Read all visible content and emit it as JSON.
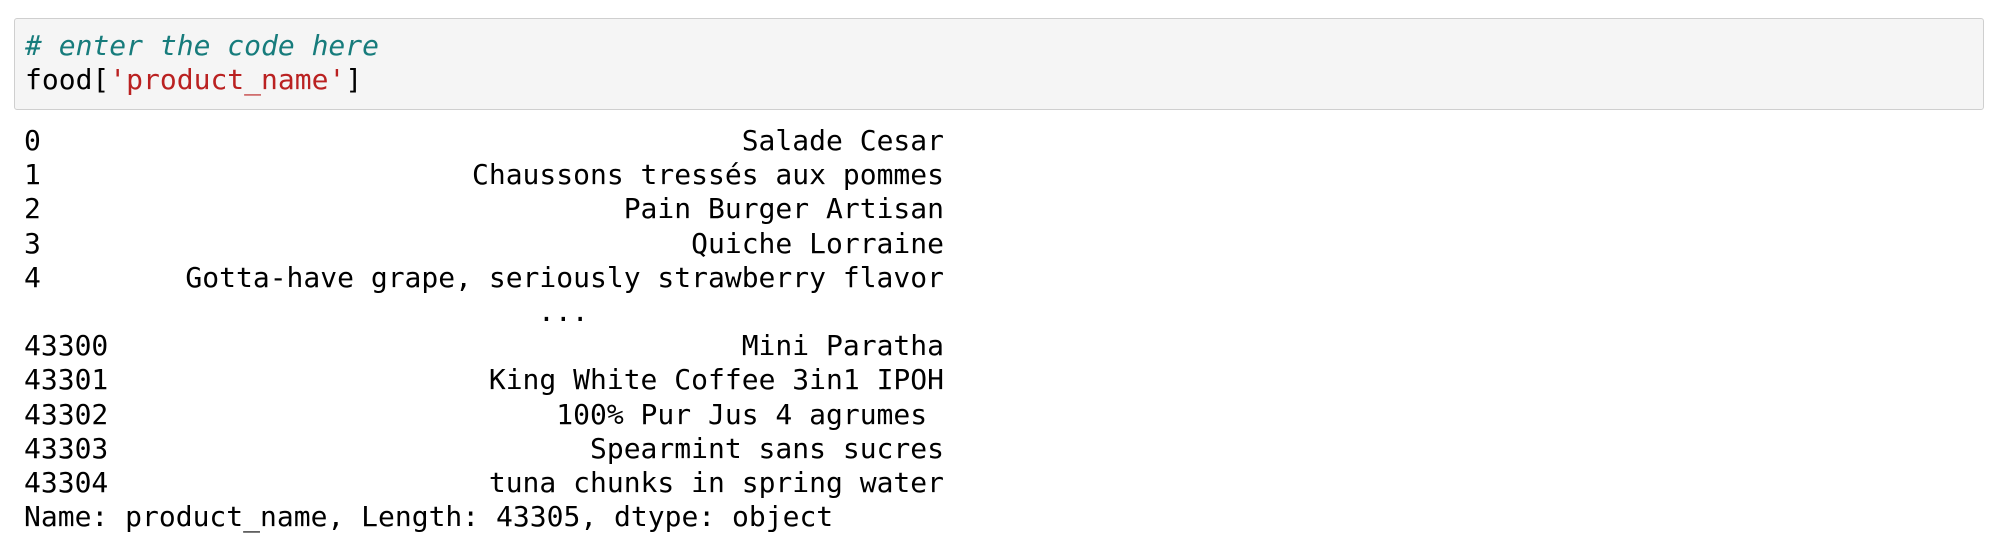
{
  "cell": {
    "comment": "# enter the code here",
    "code_prefix": "food[",
    "code_string": "'product_name'",
    "code_suffix": "]"
  },
  "output": {
    "rows_top": [
      {
        "index": "0",
        "value": "Salade Cesar"
      },
      {
        "index": "1",
        "value": "Chaussons tressés aux pommes"
      },
      {
        "index": "2",
        "value": "Pain Burger Artisan"
      },
      {
        "index": "3",
        "value": "Quiche Lorraine"
      },
      {
        "index": "4",
        "value": "Gotta-have grape, seriously strawberry flavor"
      }
    ],
    "ellipsis": "...",
    "rows_bottom": [
      {
        "index": "43300",
        "value": "Mini Paratha"
      },
      {
        "index": "43301",
        "value": "King White Coffee 3in1 IPOH"
      },
      {
        "index": "43302",
        "value": "100% Pur Jus 4 agrumes "
      },
      {
        "index": "43303",
        "value": "Spearmint sans sucres"
      },
      {
        "index": "43304",
        "value": "tuna chunks in spring water"
      }
    ],
    "footer": "Name: product_name, Length: 43305, dtype: object"
  },
  "colors": {
    "comment": "#177c7c",
    "string": "#ba2121",
    "cell_background": "#f5f5f5",
    "cell_border": "#cfcfcf"
  }
}
